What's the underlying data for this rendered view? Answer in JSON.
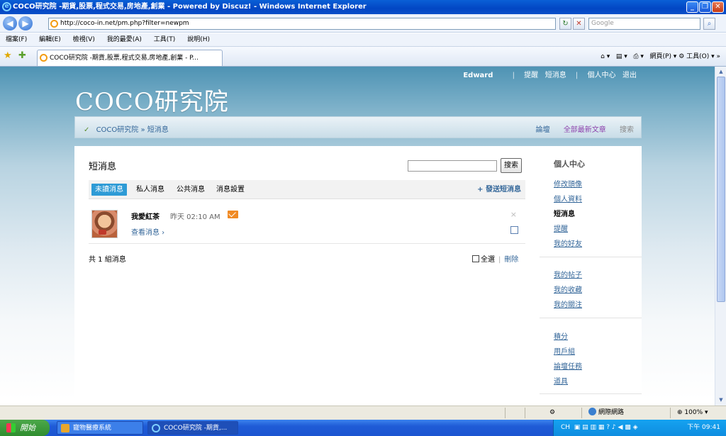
{
  "window": {
    "title": "COCO研究院 -期貨,股票,程式交易,房地產,創業 - Powered by Discuz! - Windows Internet Explorer",
    "min": "_",
    "max": "❐",
    "close": "✕"
  },
  "address": {
    "url": "http://coco-in.net/pm.php?filter=newpm",
    "search_placeholder": "Google"
  },
  "menu": [
    "檔案(F)",
    "編輯(E)",
    "檢視(V)",
    "我的最愛(A)",
    "工具(T)",
    "說明(H)"
  ],
  "browser_tab": {
    "title": "COCO研究院 -期貨,股票,程式交易,房地產,創業 - P...",
    "tools": "網頁(P) ▾ ⚙ 工具(O) ▾"
  },
  "site": {
    "logo": "COCO研究院",
    "user": "Edward",
    "user_links": [
      "提醒",
      "短消息",
      "個人中心",
      "退出"
    ],
    "breadcrumb_home": "COCO研究院",
    "breadcrumb_sep": "»",
    "breadcrumb_current": "短消息",
    "top_nav": [
      "論壇",
      "全部最新文章",
      "搜索"
    ]
  },
  "pm": {
    "title": "短消息",
    "search_button": "搜索",
    "tabs": [
      "未讀消息",
      "私人消息",
      "公共消息",
      "消息設置"
    ],
    "send_label": "+ 發送短消息",
    "message": {
      "from": "我愛紅茶",
      "time": "昨天 02:10 AM",
      "view": "查看消息 ›",
      "delete": "×"
    },
    "count_text": "共 1 組消息",
    "select_all": "全選",
    "delete_label": "刪除"
  },
  "sidebar": {
    "heading": "個人中心",
    "group1": [
      "修改頭像",
      "個人資料",
      "短消息",
      "提醒",
      "我的好友"
    ],
    "group2": [
      "我的帖子",
      "我的收藏",
      "我的關注"
    ],
    "group3": [
      "積分",
      "用戶組",
      "論壇任務",
      "道具"
    ]
  },
  "status": {
    "zone": "網際網路",
    "zoom": "100%"
  },
  "taskbar": {
    "start": "開始",
    "tasks": [
      "寵物醫療系統",
      "COCO研究院 -期貨,..."
    ],
    "tray": "CH",
    "clock": "下午 09:41"
  }
}
